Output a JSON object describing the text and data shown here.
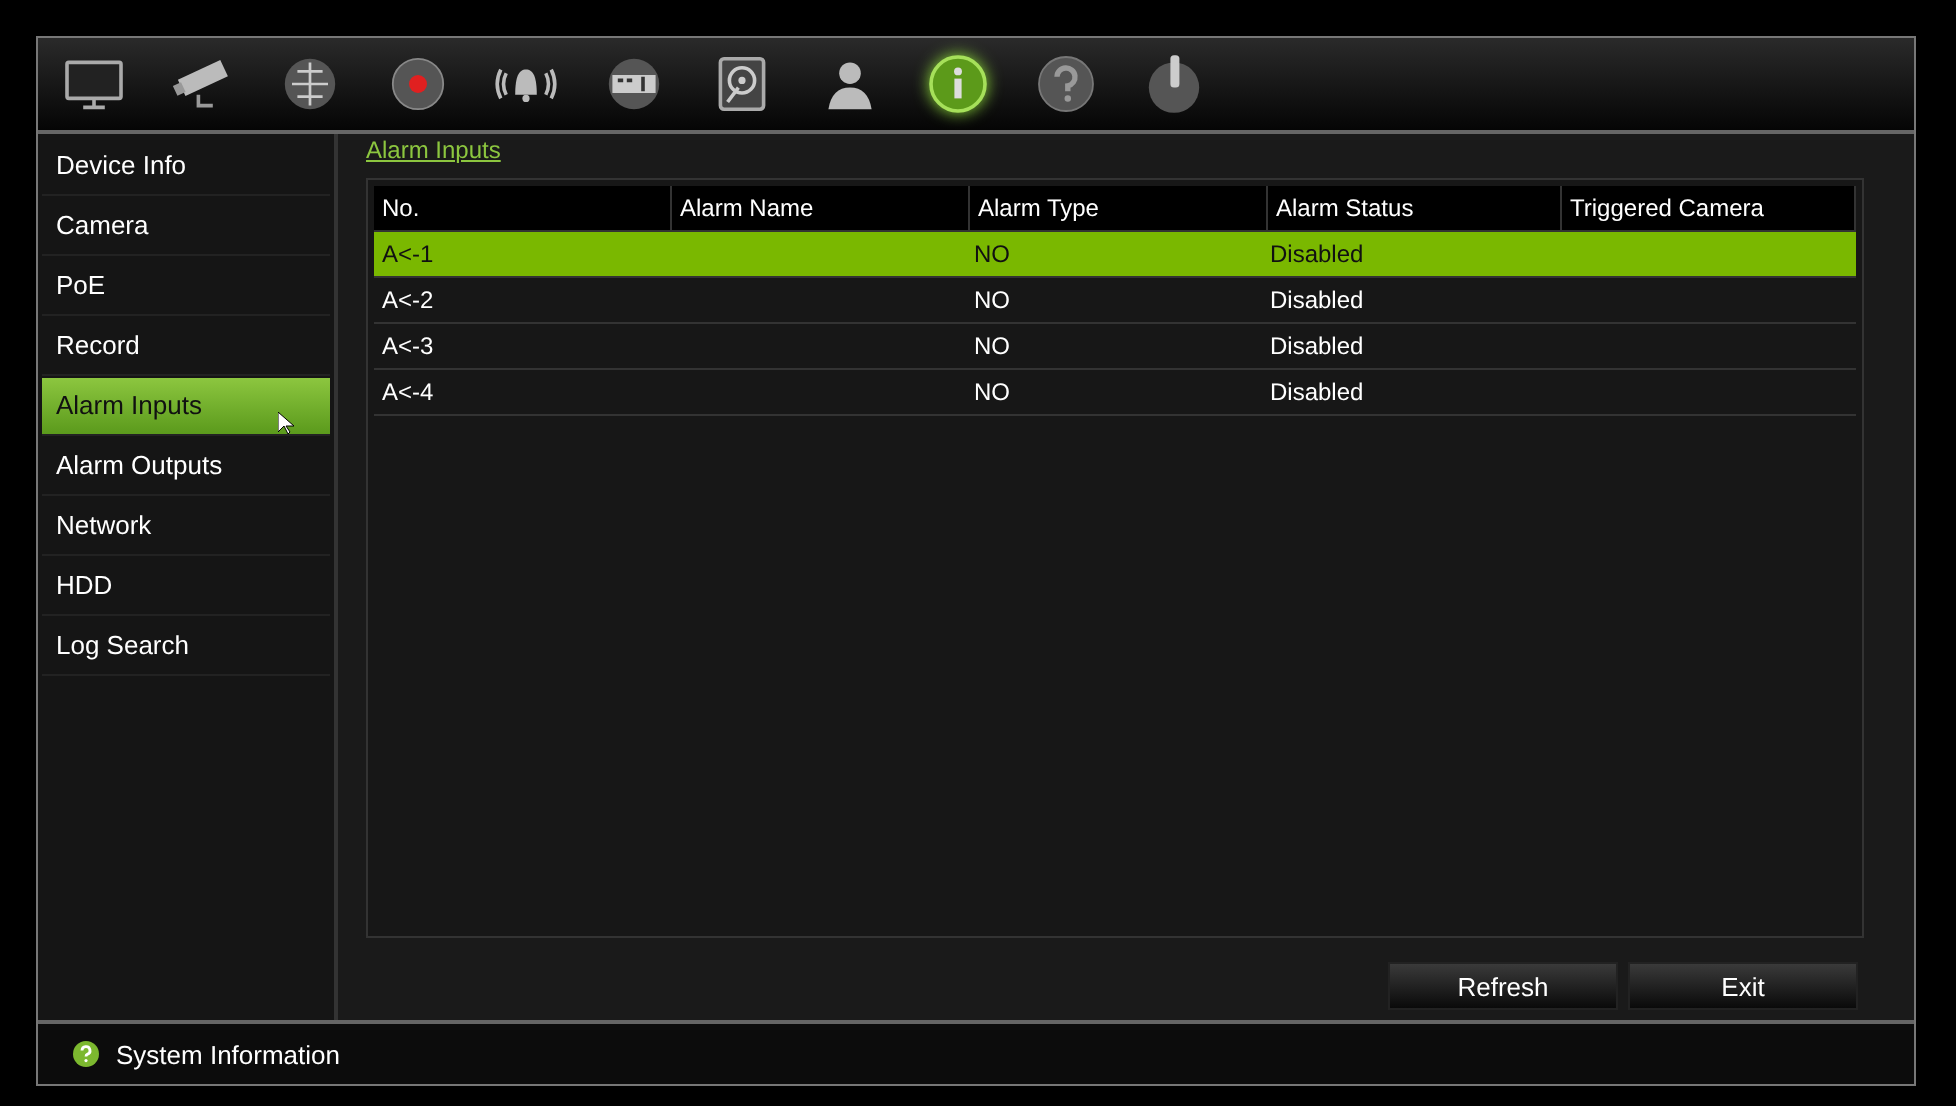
{
  "toolbar": [
    {
      "kind": "monitor",
      "selected": false
    },
    {
      "kind": "camera",
      "selected": false
    },
    {
      "kind": "network",
      "selected": false
    },
    {
      "kind": "record",
      "selected": false
    },
    {
      "kind": "alarm",
      "selected": false
    },
    {
      "kind": "device",
      "selected": false
    },
    {
      "kind": "disk",
      "selected": false
    },
    {
      "kind": "user",
      "selected": false
    },
    {
      "kind": "info",
      "selected": true
    },
    {
      "kind": "help",
      "selected": false
    },
    {
      "kind": "power",
      "selected": false
    }
  ],
  "sidebar": {
    "items": [
      {
        "label": "Device Info",
        "selected": false
      },
      {
        "label": "Camera",
        "selected": false
      },
      {
        "label": "PoE",
        "selected": false
      },
      {
        "label": "Record",
        "selected": false
      },
      {
        "label": "Alarm Inputs",
        "selected": true
      },
      {
        "label": "Alarm Outputs",
        "selected": false
      },
      {
        "label": "Network",
        "selected": false
      },
      {
        "label": "HDD",
        "selected": false
      },
      {
        "label": "Log Search",
        "selected": false
      }
    ]
  },
  "page_title": "Alarm Inputs",
  "table": {
    "columns": [
      "No.",
      "Alarm Name",
      "Alarm Type",
      "Alarm Status",
      "Triggered Camera"
    ],
    "rows": [
      {
        "cells": [
          "A<-1",
          "",
          "NO",
          "Disabled",
          ""
        ],
        "selected": true
      },
      {
        "cells": [
          "A<-2",
          "",
          "NO",
          "Disabled",
          ""
        ],
        "selected": false
      },
      {
        "cells": [
          "A<-3",
          "",
          "NO",
          "Disabled",
          ""
        ],
        "selected": false
      },
      {
        "cells": [
          "A<-4",
          "",
          "NO",
          "Disabled",
          ""
        ],
        "selected": false
      }
    ]
  },
  "buttons": [
    "Refresh",
    "Exit"
  ],
  "status_bar": {
    "text": "System Information"
  }
}
